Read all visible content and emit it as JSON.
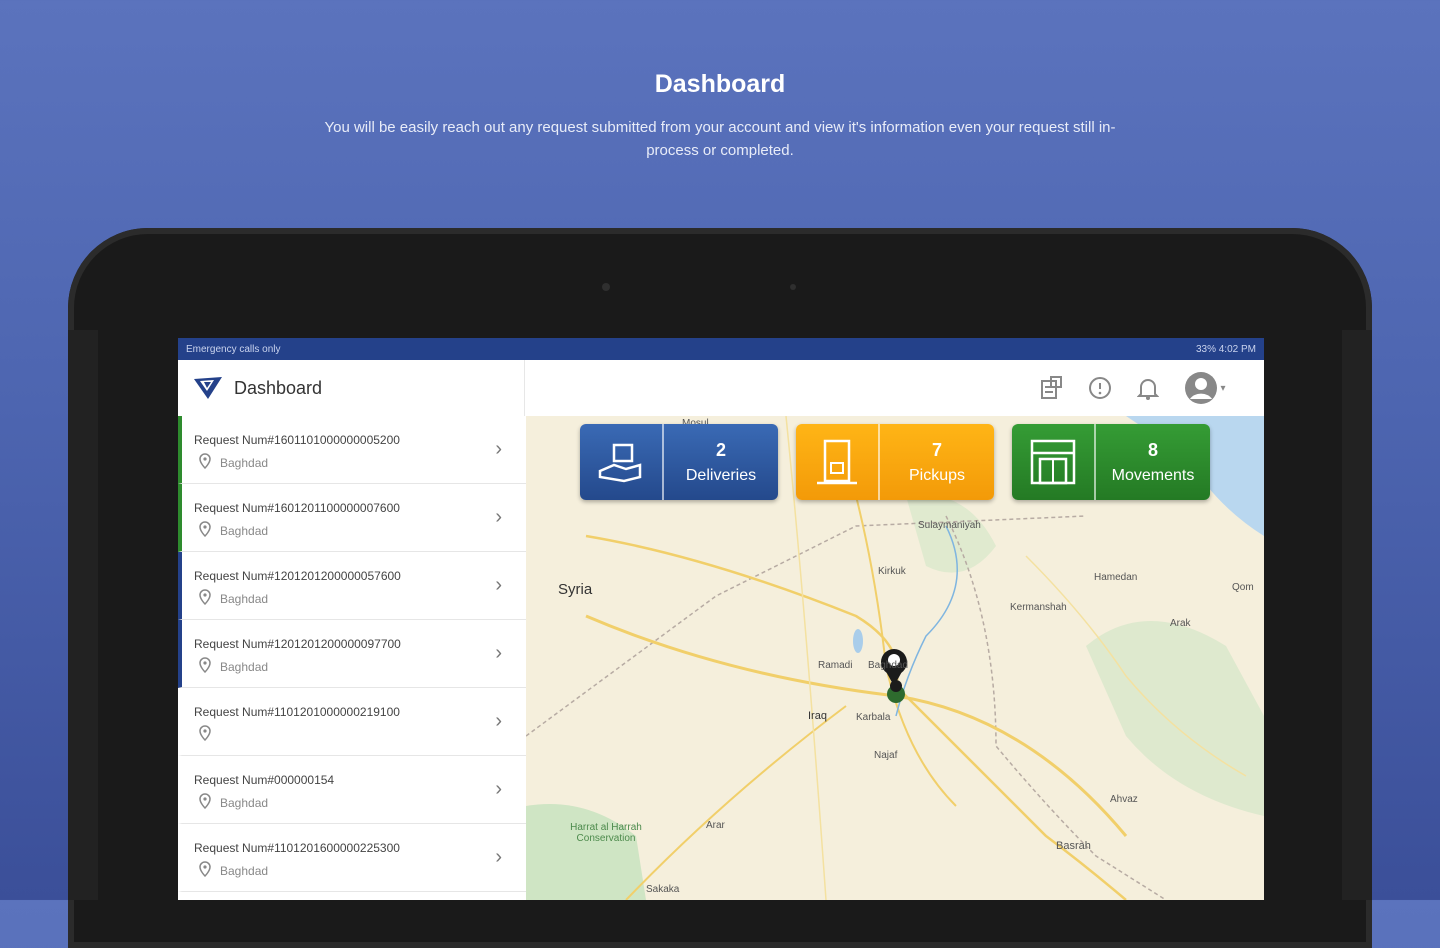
{
  "promo": {
    "title": "Dashboard",
    "description": "You will be easily reach out any request submitted from your account and view it's information even your request still in-process or completed."
  },
  "statusbar": {
    "left": "Emergency calls only",
    "right": "33% 4:02 PM"
  },
  "appbar": {
    "title": "Dashboard",
    "icons": [
      "requests-icon",
      "info-icon",
      "bell-icon",
      "account-icon"
    ]
  },
  "colors": {
    "deliveries": "#2d5aa3",
    "pickups": "#f4a50e",
    "movements": "#2e8b2e",
    "appbar_status": "#24418a"
  },
  "cards": {
    "deliveries": {
      "count": "2",
      "label": "Deliveries"
    },
    "pickups": {
      "count": "7",
      "label": "Pickups"
    },
    "movements": {
      "count": "8",
      "label": "Movements"
    }
  },
  "requests": [
    {
      "title": "Request Num#1601101000000005200",
      "location": "Baghdad",
      "accent": "#2e8b2e"
    },
    {
      "title": "Request Num#1601201100000007600",
      "location": "Baghdad",
      "accent": "#2e8b2e"
    },
    {
      "title": "Request Num#1201201200000057600",
      "location": "Baghdad",
      "accent": "#24418a"
    },
    {
      "title": "Request Num#1201201200000097700",
      "location": "Baghdad",
      "accent": "#24418a"
    },
    {
      "title": "Request Num#1101201000000219100",
      "location": "",
      "accent": "transparent"
    },
    {
      "title": "Request Num#000000154",
      "location": "Baghdad",
      "accent": "transparent"
    },
    {
      "title": "Request Num#1101201600000225300",
      "location": "Baghdad",
      "accent": "transparent"
    }
  ],
  "map": {
    "labels": [
      "Syria",
      "Iraq",
      "Baghdad",
      "Karbala",
      "Najaf",
      "Basrah",
      "Ramadi",
      "Kirkuk",
      "Sulaymaniyah",
      "Hamedan",
      "Kermanshah",
      "Arak",
      "Qom",
      "Ahvaz",
      "Sakaka",
      "Arar",
      "Mosul",
      "Harrat al Harrah Conservation"
    ]
  }
}
